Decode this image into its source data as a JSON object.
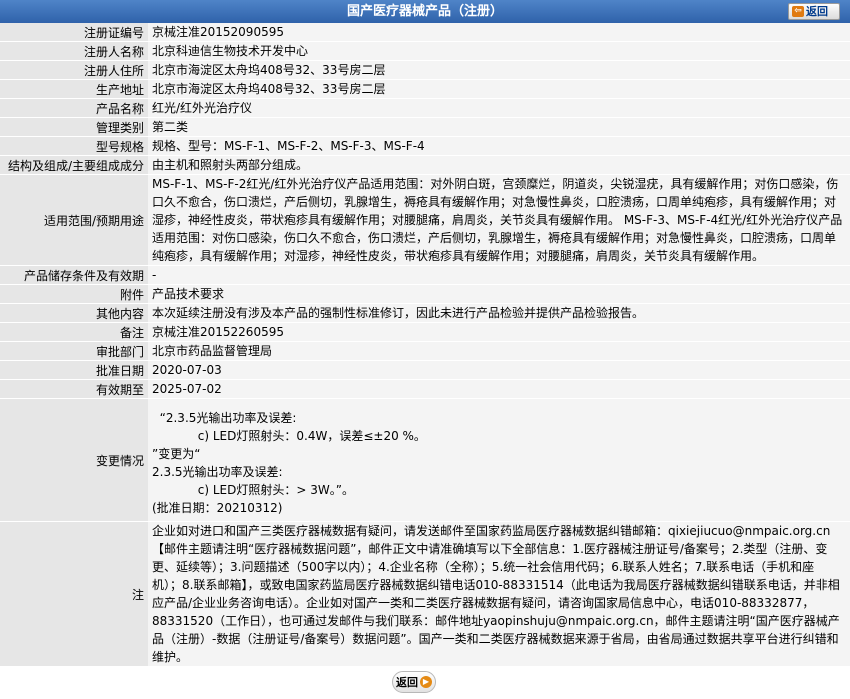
{
  "header": {
    "title": "国产医疗器械产品（注册）",
    "back_label": "返回"
  },
  "fields": [
    {
      "label": "注册证编号",
      "value": "京械注准20152090595"
    },
    {
      "label": "注册人名称",
      "value": "北京科迪信生物技术开发中心"
    },
    {
      "label": "注册人住所",
      "value": "北京市海淀区太舟坞408号32、33号房二层"
    },
    {
      "label": "生产地址",
      "value": "北京市海淀区太舟坞408号32、33号房二层"
    },
    {
      "label": "产品名称",
      "value": "红光/红外光治疗仪"
    },
    {
      "label": "管理类别",
      "value": "第二类"
    },
    {
      "label": "型号规格",
      "value": "规格、型号：MS-F-1、MS-F-2、MS-F-3、MS-F-4"
    },
    {
      "label": "结构及组成/主要组成成分",
      "value": "由主机和照射头两部分组成。"
    },
    {
      "label": "适用范围/预期用途",
      "value": "MS-F-1、MS-F-2红光/红外光治疗仪产品适用范围：对外阴白斑，宫颈糜烂，阴道炎，尖锐湿疣，具有缓解作用；对伤口感染，伤口久不愈合，伤口溃烂，产后侧切，乳腺增生，褥疮具有缓解作用；对急慢性鼻炎，口腔溃疡，口周单纯疱疹，具有缓解作用；对湿疹，神经性皮炎，带状疱疹具有缓解作用；对腰腿痛，肩周炎，关节炎具有缓解作用。 MS-F-3、MS-F-4红光/红外光治疗仪产品适用范围：对伤口感染，伤口久不愈合，伤口溃烂，产后侧切，乳腺增生，褥疮具有缓解作用；对急慢性鼻炎，口腔溃疡，口周单纯疱疹，具有缓解作用；对湿疹，神经性皮炎，带状疱疹具有缓解作用；对腰腿痛，肩周炎，关节炎具有缓解作用。"
    },
    {
      "label": "产品储存条件及有效期",
      "value": "-"
    },
    {
      "label": "附件",
      "value": "产品技术要求"
    },
    {
      "label": "其他内容",
      "value": "本次延续注册没有涉及本产品的强制性标准修订，因此未进行产品检验并提供产品检验报告。"
    },
    {
      "label": "备注",
      "value": "京械注准20152260595"
    },
    {
      "label": "审批部门",
      "value": "北京市药品监督管理局"
    },
    {
      "label": "批准日期",
      "value": "2020-07-03"
    },
    {
      "label": "有效期至",
      "value": "2025-07-02"
    },
    {
      "label": "变更情况",
      "value": "  “2.3.5光输出功率及误差:\n            c) LED灯照射头：0.4W，误差≤±20 %。\n”变更为“\n2.3.5光输出功率及误差:\n            c) LED灯照射头：> 3W。”。\n(批准日期：20210312)"
    },
    {
      "label": "注",
      "value": "企业如对进口和国产三类医疗器械数据有疑问，请发送邮件至国家药监局医疗器械数据纠错邮箱：qixiejiucuo@nmpaic.org.cn【邮件主题请注明“医疗器械数据问题”，邮件正文中请准确填写以下全部信息：1.医疗器械注册证号/备案号；2.类型（注册、变更、延续等）；3.问题描述（500字以内）；4.企业名称（全称）；5.统一社会信用代码；6.联系人姓名；7.联系电话（手机和座机）；8.联系邮箱】，或致电国家药监局医疗器械数据纠错电话010-88331514（此电话为我局医疗器械数据纠错联系电话，并非相应产品/企业业务咨询电话）。企业如对国产一类和二类医疗器械数据有疑问，请咨询国家局信息中心，电话010-88332877，88331520（工作日），也可通过发邮件与我们联系：邮件地址yaopinshuju@nmpaic.org.cn，邮件主题请注明“国产医疗器械产品（注册）-数据（注册证号/备案号）数据问题”。国产一类和二类医疗器械数据来源于省局，由省局通过数据共享平台进行纠错和维护。"
    }
  ],
  "footer": {
    "back_label": "返回"
  }
}
